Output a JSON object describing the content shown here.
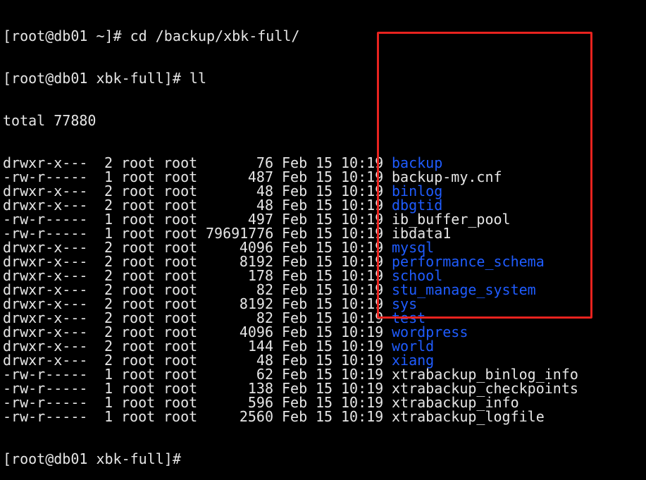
{
  "commands": {
    "prompt1": "[root@db01 ~]# cd /backup/xbk-full/",
    "prompt2": "[root@db01 xbk-full]# ll",
    "total": "total 77880",
    "prompt3": "[root@db01 xbk-full]#"
  },
  "listing": [
    {
      "perm": "drwxr-x---",
      "links": "2",
      "owner": "root",
      "group": "root",
      "size": "76",
      "month": "Feb",
      "day": "15",
      "time": "10:19",
      "name": "backup",
      "is_dir": true
    },
    {
      "perm": "-rw-r-----",
      "links": "1",
      "owner": "root",
      "group": "root",
      "size": "487",
      "month": "Feb",
      "day": "15",
      "time": "10:19",
      "name": "backup-my.cnf",
      "is_dir": false
    },
    {
      "perm": "drwxr-x---",
      "links": "2",
      "owner": "root",
      "group": "root",
      "size": "48",
      "month": "Feb",
      "day": "15",
      "time": "10:19",
      "name": "binlog",
      "is_dir": true
    },
    {
      "perm": "drwxr-x---",
      "links": "2",
      "owner": "root",
      "group": "root",
      "size": "48",
      "month": "Feb",
      "day": "15",
      "time": "10:19",
      "name": "dbgtid",
      "is_dir": true
    },
    {
      "perm": "-rw-r-----",
      "links": "1",
      "owner": "root",
      "group": "root",
      "size": "497",
      "month": "Feb",
      "day": "15",
      "time": "10:19",
      "name": "ib_buffer_pool",
      "is_dir": false
    },
    {
      "perm": "-rw-r-----",
      "links": "1",
      "owner": "root",
      "group": "root",
      "size": "79691776",
      "month": "Feb",
      "day": "15",
      "time": "10:19",
      "name": "ibdata1",
      "is_dir": false
    },
    {
      "perm": "drwxr-x---",
      "links": "2",
      "owner": "root",
      "group": "root",
      "size": "4096",
      "month": "Feb",
      "day": "15",
      "time": "10:19",
      "name": "mysql",
      "is_dir": true
    },
    {
      "perm": "drwxr-x---",
      "links": "2",
      "owner": "root",
      "group": "root",
      "size": "8192",
      "month": "Feb",
      "day": "15",
      "time": "10:19",
      "name": "performance_schema",
      "is_dir": true
    },
    {
      "perm": "drwxr-x---",
      "links": "2",
      "owner": "root",
      "group": "root",
      "size": "178",
      "month": "Feb",
      "day": "15",
      "time": "10:19",
      "name": "school",
      "is_dir": true
    },
    {
      "perm": "drwxr-x---",
      "links": "2",
      "owner": "root",
      "group": "root",
      "size": "82",
      "month": "Feb",
      "day": "15",
      "time": "10:19",
      "name": "stu_manage_system",
      "is_dir": true
    },
    {
      "perm": "drwxr-x---",
      "links": "2",
      "owner": "root",
      "group": "root",
      "size": "8192",
      "month": "Feb",
      "day": "15",
      "time": "10:19",
      "name": "sys",
      "is_dir": true
    },
    {
      "perm": "drwxr-x---",
      "links": "2",
      "owner": "root",
      "group": "root",
      "size": "82",
      "month": "Feb",
      "day": "15",
      "time": "10:19",
      "name": "test",
      "is_dir": true
    },
    {
      "perm": "drwxr-x---",
      "links": "2",
      "owner": "root",
      "group": "root",
      "size": "4096",
      "month": "Feb",
      "day": "15",
      "time": "10:19",
      "name": "wordpress",
      "is_dir": true
    },
    {
      "perm": "drwxr-x---",
      "links": "2",
      "owner": "root",
      "group": "root",
      "size": "144",
      "month": "Feb",
      "day": "15",
      "time": "10:19",
      "name": "world",
      "is_dir": true
    },
    {
      "perm": "drwxr-x---",
      "links": "2",
      "owner": "root",
      "group": "root",
      "size": "48",
      "month": "Feb",
      "day": "15",
      "time": "10:19",
      "name": "xiang",
      "is_dir": true
    },
    {
      "perm": "-rw-r-----",
      "links": "1",
      "owner": "root",
      "group": "root",
      "size": "62",
      "month": "Feb",
      "day": "15",
      "time": "10:19",
      "name": "xtrabackup_binlog_info",
      "is_dir": false
    },
    {
      "perm": "-rw-r-----",
      "links": "1",
      "owner": "root",
      "group": "root",
      "size": "138",
      "month": "Feb",
      "day": "15",
      "time": "10:19",
      "name": "xtrabackup_checkpoints",
      "is_dir": false
    },
    {
      "perm": "-rw-r-----",
      "links": "1",
      "owner": "root",
      "group": "root",
      "size": "596",
      "month": "Feb",
      "day": "15",
      "time": "10:19",
      "name": "xtrabackup_info",
      "is_dir": false
    },
    {
      "perm": "-rw-r-----",
      "links": "1",
      "owner": "root",
      "group": "root",
      "size": "2560",
      "month": "Feb",
      "day": "15",
      "time": "10:19",
      "name": "xtrabackup_logfile",
      "is_dir": false
    }
  ],
  "colors": {
    "background": "#000000",
    "text": "#e6e6e6",
    "directory": "#1f5cff",
    "highlight_border": "#e8231f"
  }
}
